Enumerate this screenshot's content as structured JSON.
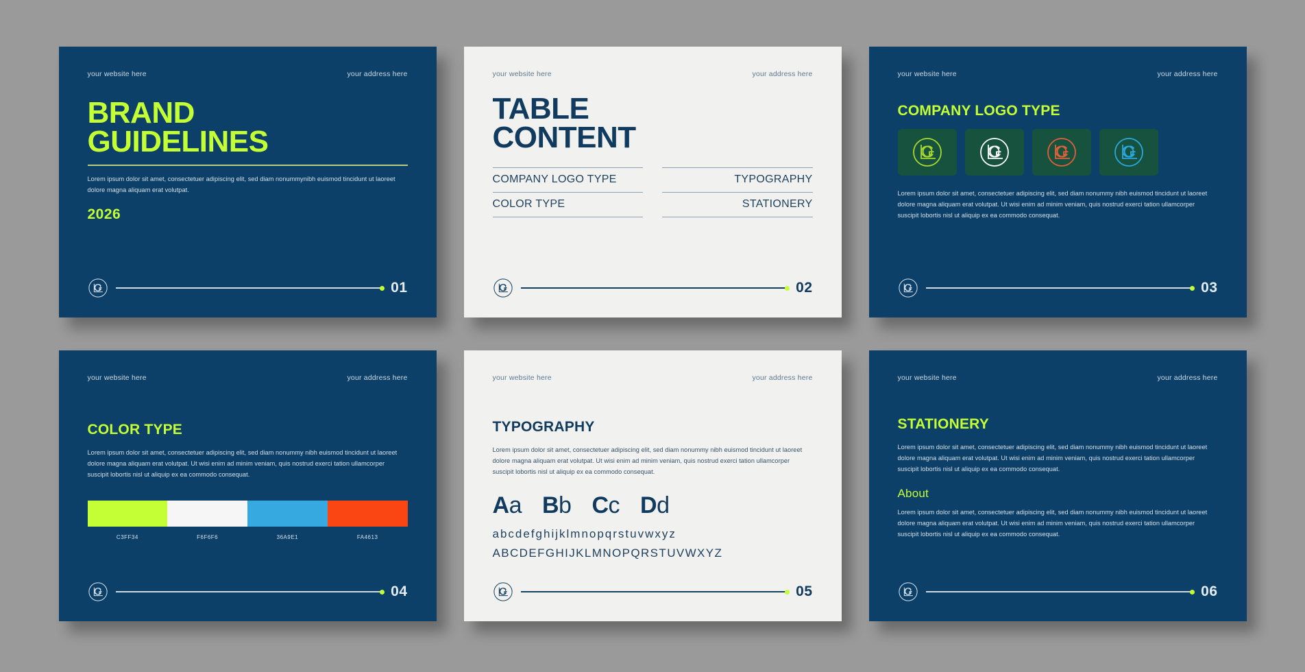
{
  "brand": {
    "accent_lime": "#C3FF34",
    "deep_blue": "#0D4068",
    "title_blue": "#103A5E",
    "paper": "#F1F1EF",
    "canvas_gray": "#9A9A9A",
    "logo_mark": "LCG"
  },
  "header": {
    "website": "your website here",
    "address": "your address here"
  },
  "lorem": {
    "cover": "Lorem ipsum dolor sit amet, consectetuer adipiscing elit, sed diam nonummynibh euismod tincidunt ut laoreet dolore magna aliquam erat volutpat.",
    "full": "Lorem ipsum dolor sit amet, consectetuer adipiscing elit, sed diam nonummy nibh euismod tincidunt ut laoreet dolore magna aliquam erat volutpat. Ut wisi enim ad minim veniam, quis nostrud exerci tation ullamcorper suscipit lobortis nisl ut aliquip ex ea commodo consequat."
  },
  "slides": [
    {
      "number": "01",
      "theme": "dark",
      "title_line1": "BRAND",
      "title_line2": "GUIDELINES",
      "year": "2026"
    },
    {
      "number": "02",
      "theme": "light",
      "title_line1": "TABLE",
      "title_line2": "CONTENT",
      "toc_left": [
        "COMPANY LOGO TYPE",
        "COLOR TYPE"
      ],
      "toc_right": [
        "TYPOGRAPHY",
        "STATIONERY"
      ]
    },
    {
      "number": "03",
      "theme": "dark",
      "title": "COMPANY LOGO TYPE",
      "logo_variants": [
        {
          "name": "lime-logo",
          "stroke": "#A8D92E",
          "bg": "#17523F"
        },
        {
          "name": "white-logo",
          "stroke": "#FFFFFF",
          "bg": "#17523F"
        },
        {
          "name": "orange-logo",
          "stroke": "#E1603A",
          "bg": "#17523F"
        },
        {
          "name": "cyan-logo",
          "stroke": "#2BA8DE",
          "bg": "#17523F"
        }
      ]
    },
    {
      "number": "04",
      "theme": "dark",
      "title": "COLOR TYPE",
      "palette": [
        {
          "hex": "#C3FF34",
          "label": "C3FF34"
        },
        {
          "hex": "#F6F6F6",
          "label": "F6F6F6"
        },
        {
          "hex": "#36A9E1",
          "label": "36A9E1"
        },
        {
          "hex": "#FA4613",
          "label": "FA4613"
        }
      ]
    },
    {
      "number": "05",
      "theme": "light",
      "title": "TYPOGRAPHY",
      "specimens": [
        {
          "upper": "A",
          "lower": "a"
        },
        {
          "upper": "B",
          "lower": "b"
        },
        {
          "upper": "C",
          "lower": "c"
        },
        {
          "upper": "D",
          "lower": "d"
        }
      ],
      "alphabet_lower": "abcdefghijklmnopqrstuvwxyz",
      "alphabet_upper": "ABCDEFGHIJKLMNOPQRSTUVWXYZ"
    },
    {
      "number": "06",
      "theme": "dark",
      "title": "STATIONERY",
      "subheading": "About"
    }
  ]
}
